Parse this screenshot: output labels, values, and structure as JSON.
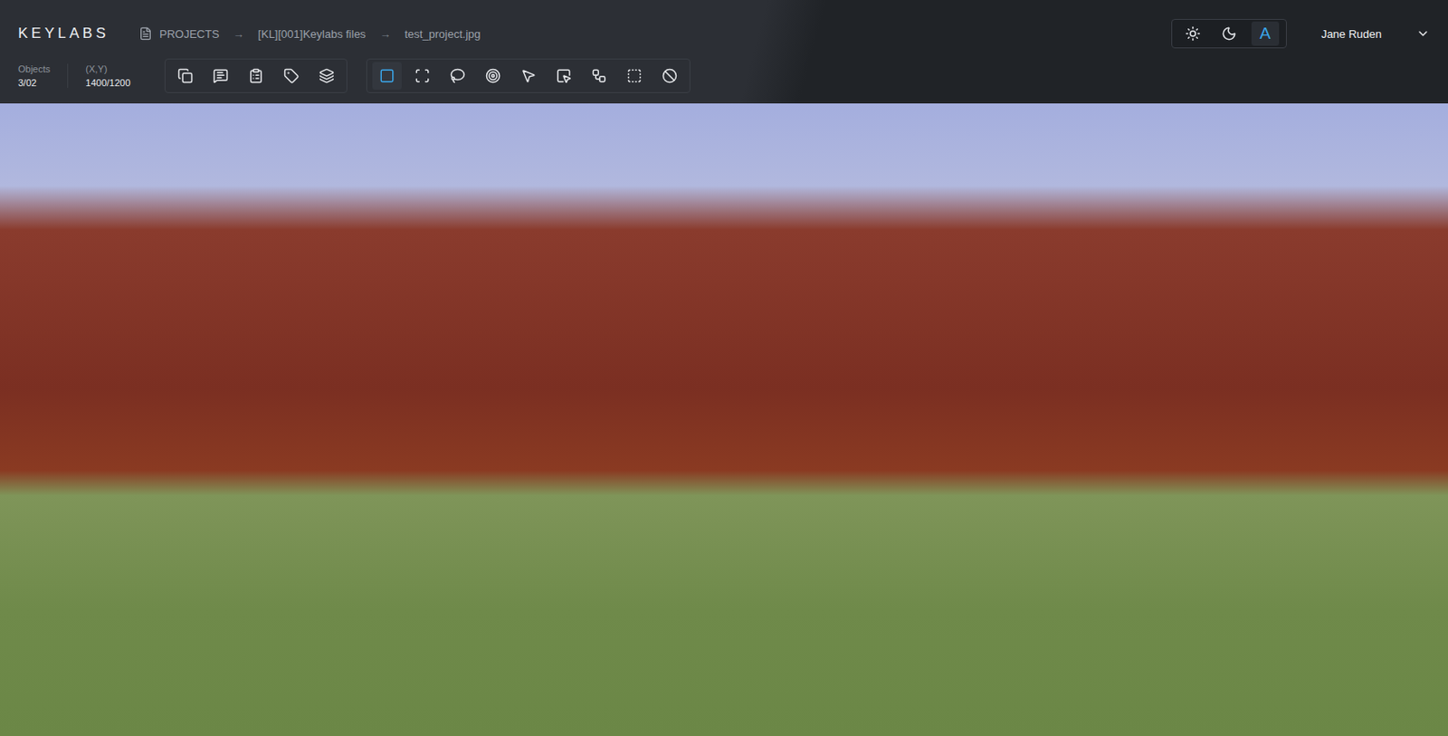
{
  "app": {
    "logo": "KEYLABS"
  },
  "breadcrumbs": [
    {
      "label": "PROJECTS"
    },
    {
      "label": "[KL][001]Keylabs files"
    },
    {
      "label": "test_project.jpg"
    }
  ],
  "breadcrumb_separator": "→",
  "theme_switch": [
    {
      "selected": false
    },
    {
      "selected": false
    },
    {
      "label": "A",
      "selected": true
    }
  ],
  "user": {
    "name": "Jane Ruden"
  },
  "stats": [
    {
      "label": "Objects",
      "value": "3/02"
    },
    {
      "label": "(X,Y)",
      "value": "1400/1200"
    }
  ],
  "panel_tools": [
    {
      "selected": false
    },
    {
      "selected": false
    },
    {
      "selected": false
    },
    {
      "selected": false
    },
    {
      "selected": false
    }
  ],
  "draw_tools": [
    {
      "selected": true
    },
    {
      "selected": false
    },
    {
      "selected": false
    },
    {
      "selected": false
    },
    {
      "selected": false
    },
    {
      "selected": false
    },
    {
      "selected": false
    },
    {
      "selected": false
    },
    {
      "selected": false
    }
  ]
}
